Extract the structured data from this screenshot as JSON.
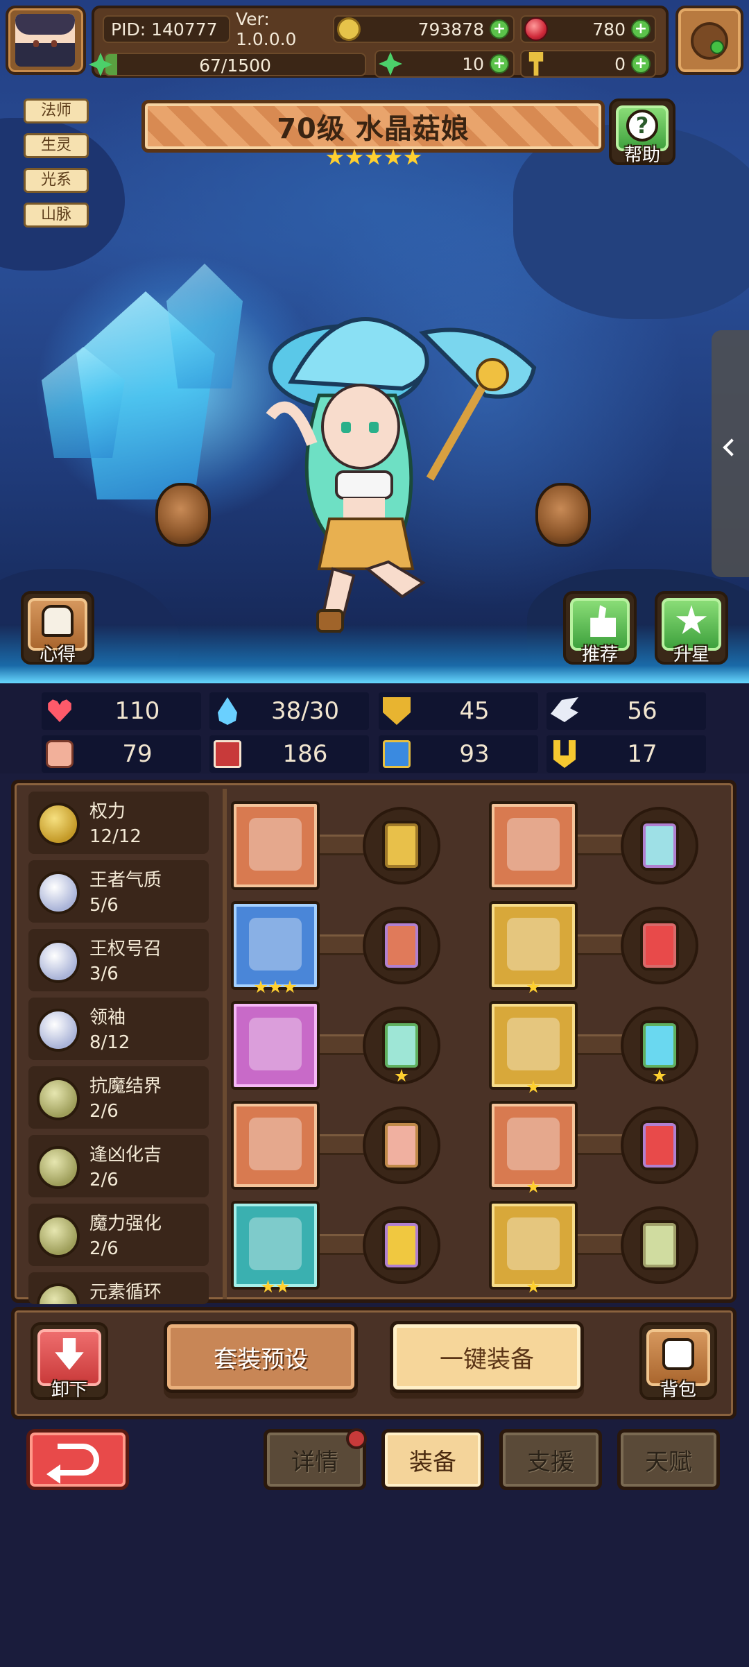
{
  "header": {
    "pid": "PID: 140777",
    "version": "Ver: 1.0.0.0",
    "gold": "793878",
    "gems": "780",
    "clover": "10",
    "hammer": "0",
    "xp_text": "67/1500",
    "xp_progress": 0.0447
  },
  "hero": {
    "tags": [
      "法师",
      "生灵",
      "光系",
      "山脉"
    ],
    "title": "70级 水晶菇娘",
    "stars": 5,
    "help_label": "帮助",
    "insight_label": "心得",
    "recommend_label": "推荐",
    "star_up_label": "升星"
  },
  "stats": [
    {
      "icon": "heart-icon",
      "value": "110"
    },
    {
      "icon": "mana-drop-icon",
      "value": "38/30"
    },
    {
      "icon": "shield-icon",
      "value": "45"
    },
    {
      "icon": "wing-icon",
      "value": "56"
    },
    {
      "icon": "fist-icon",
      "value": "79"
    },
    {
      "icon": "spellbook-icon",
      "value": "186"
    },
    {
      "icon": "boot-icon",
      "value": "93"
    },
    {
      "icon": "horseshoe-icon",
      "value": "17"
    }
  ],
  "set_bonuses": [
    {
      "name": "权力",
      "progress": "12/12",
      "medal": "gold"
    },
    {
      "name": "王者气质",
      "progress": "5/6",
      "medal": "silver"
    },
    {
      "name": "王权号召",
      "progress": "3/6",
      "medal": "silver"
    },
    {
      "name": "领袖",
      "progress": "8/12",
      "medal": "silver"
    },
    {
      "name": "抗魔结界",
      "progress": "2/6",
      "medal": "olive"
    },
    {
      "name": "逢凶化吉",
      "progress": "2/6",
      "medal": "olive"
    },
    {
      "name": "魔力强化",
      "progress": "2/6",
      "medal": "olive"
    },
    {
      "name": "元素循环",
      "progress": "",
      "medal": "olive"
    }
  ],
  "equipment": [
    {
      "slot": "weapon-staff",
      "color": "orange",
      "stars": 0,
      "gem_color": "#e8c04a",
      "gem_border": "#a07a2a",
      "gem_stars": 0
    },
    {
      "slot": "crown",
      "color": "orange",
      "stars": 0,
      "gem_color": "#9ee0e6",
      "gem_border": "#b080d0",
      "gem_stars": 0
    },
    {
      "slot": "crystal-orb",
      "color": "blue",
      "stars": 3,
      "gem_color": "#e07a5a",
      "gem_border": "#b080d0",
      "gem_stars": 0
    },
    {
      "slot": "robe",
      "color": "gold",
      "stars": 1,
      "gem_color": "#e84a4a",
      "gem_border": "#d86a6a",
      "gem_stars": 0
    },
    {
      "slot": "heart-necklace",
      "color": "pink",
      "stars": 0,
      "gem_color": "#9ee6d6",
      "gem_border": "#60b060",
      "gem_stars": 1
    },
    {
      "slot": "gloves",
      "color": "gold",
      "stars": 1,
      "gem_color": "#6ad8f0",
      "gem_border": "#60b060",
      "gem_stars": 1
    },
    {
      "slot": "jeweled-amulet",
      "color": "orange",
      "stars": 0,
      "gem_color": "#f0b0a0",
      "gem_border": "#c08a4a",
      "gem_stars": 0
    },
    {
      "slot": "ring-box",
      "color": "orange",
      "stars": 1,
      "gem_color": "#e84a4a",
      "gem_border": "#b080d0",
      "gem_stars": 0
    },
    {
      "slot": "potion-flask",
      "color": "teal",
      "stars": 2,
      "gem_color": "#f0c840",
      "gem_border": "#b080d0",
      "gem_stars": 0
    },
    {
      "slot": "boots",
      "color": "gold",
      "stars": 1,
      "gem_color": "#d0dca0",
      "gem_border": "#a0a06a",
      "gem_stars": 0
    }
  ],
  "actions": {
    "unequip_label": "卸下",
    "preset_label": "套装预设",
    "auto_equip_label": "一键装备",
    "bag_label": "背包"
  },
  "tabs": [
    {
      "label": "详情",
      "active": false,
      "notify": true
    },
    {
      "label": "装备",
      "active": true,
      "notify": false
    },
    {
      "label": "支援",
      "active": false,
      "notify": false
    },
    {
      "label": "天赋",
      "active": false,
      "notify": false
    }
  ]
}
